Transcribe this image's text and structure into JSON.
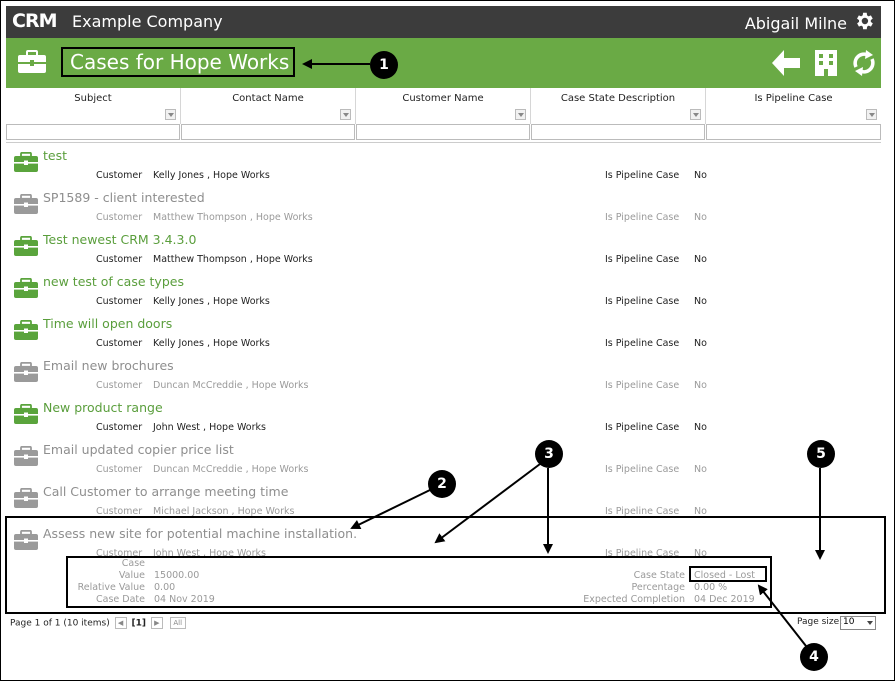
{
  "app": {
    "logo": "CRM",
    "company": "Example Company",
    "user": "Abigail Milne"
  },
  "page": {
    "title": "Cases for Hope Works"
  },
  "columns": [
    "Subject",
    "Contact Name",
    "Customer Name",
    "Case State Description",
    "Is Pipeline Case"
  ],
  "row_labels": {
    "customer": "Customer",
    "pipeline": "Is Pipeline Case"
  },
  "rows": [
    {
      "subject": "test",
      "customer": "Kelly Jones , Hope Works",
      "pipeline": "No",
      "active": true
    },
    {
      "subject": "SP1589 - client interested",
      "customer": "Matthew Thompson , Hope Works",
      "pipeline": "No",
      "active": false
    },
    {
      "subject": "Test newest CRM 3.4.3.0",
      "customer": "Matthew Thompson , Hope Works",
      "pipeline": "No",
      "active": true
    },
    {
      "subject": "new test of case types",
      "customer": "Kelly Jones , Hope Works",
      "pipeline": "No",
      "active": true
    },
    {
      "subject": "Time will open doors",
      "customer": "Kelly Jones , Hope Works",
      "pipeline": "No",
      "active": true
    },
    {
      "subject": "Email new brochures",
      "customer": "Duncan McCreddie , Hope Works",
      "pipeline": "No",
      "active": false
    },
    {
      "subject": "New product range",
      "customer": "John West , Hope Works",
      "pipeline": "No",
      "active": true
    },
    {
      "subject": "Email updated copier price list",
      "customer": "Duncan McCreddie , Hope Works",
      "pipeline": "No",
      "active": false
    },
    {
      "subject": "Call Customer to arrange meeting time",
      "customer": "Michael Jackson , Hope Works",
      "pipeline": "No",
      "active": false
    },
    {
      "subject": "Assess new site for potential machine installation.",
      "customer": "John West , Hope Works",
      "pipeline": "No",
      "active": false
    }
  ],
  "details": {
    "case_label": "Case",
    "value_label": "Value",
    "value": "15000.00",
    "relvalue_label": "Relative Value",
    "relvalue": "0.00",
    "casedate_label": "Case Date",
    "casedate": "04 Nov 2019",
    "state_label": "Case State",
    "state": "Closed - Lost",
    "pct_label": "Percentage",
    "pct": "0.00 %",
    "expected_label": "Expected Completion",
    "expected": "04 Dec 2019"
  },
  "pager": {
    "summary": "Page 1 of 1 (10 items)",
    "current": "[1]",
    "all": "All",
    "page_size_label": "Page size:",
    "page_size": "10"
  },
  "markers": [
    "1",
    "2",
    "3",
    "4",
    "5"
  ],
  "colors": {
    "topbar": "#3c3c3c",
    "accent": "#6aaa45",
    "active_text": "#5a9e3c",
    "inactive_text": "#8e8e8e"
  }
}
